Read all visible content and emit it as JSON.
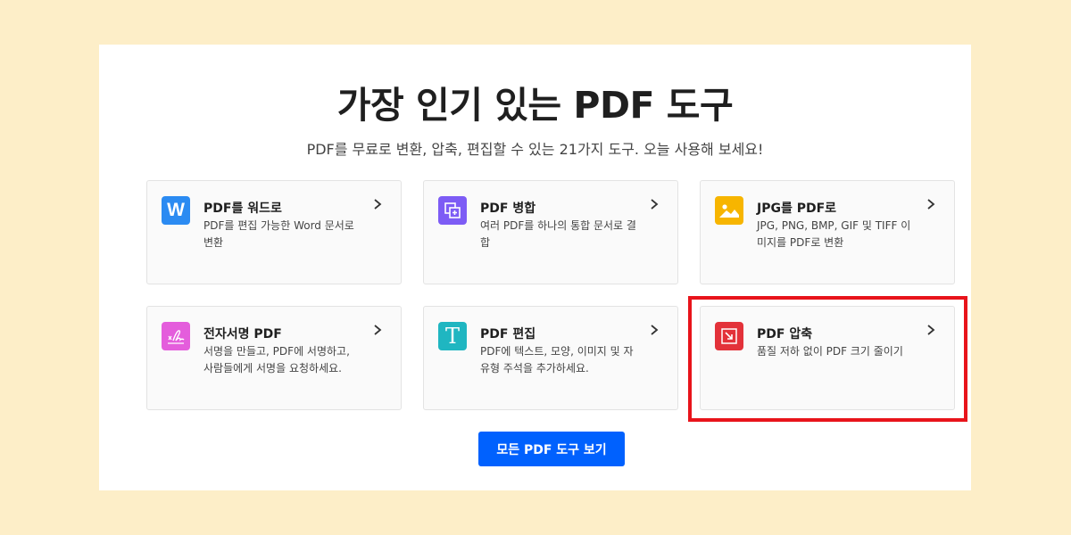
{
  "header": {
    "title": "가장 인기 있는 PDF 도구",
    "subtitle": "PDF를 무료로 변환, 압축, 편집할 수 있는 21가지 도구. 오늘 사용해 보세요!"
  },
  "tools": [
    {
      "name": "PDF를 워드로",
      "desc": "PDF를 편집 가능한 Word 문서로 변환",
      "icon": "word-icon",
      "icon_glyph": "W",
      "color": "#2b8bf2"
    },
    {
      "name": "PDF 병합",
      "desc": "여러 PDF를 하나의 통합 문서로 결합",
      "icon": "merge-icon",
      "color": "#7d5cf5"
    },
    {
      "name": "JPG를 PDF로",
      "desc": "JPG, PNG, BMP, GIF 및 TIFF 이미지를 PDF로 변환",
      "icon": "image-icon",
      "color": "#f7b500"
    },
    {
      "name": "전자서명 PDF",
      "desc": "서명을 만들고, PDF에 서명하고, 사람들에게 서명을 요청하세요.",
      "icon": "signature-icon",
      "color": "#e45ddc"
    },
    {
      "name": "PDF 편집",
      "desc": "PDF에 텍스트, 모양, 이미지 및 자유형 주석을 추가하세요.",
      "icon": "text-edit-icon",
      "icon_glyph": "T",
      "color": "#1fb6c1"
    },
    {
      "name": "PDF 압축",
      "desc": "품질 저하 없이 PDF 크기 줄이기",
      "icon": "compress-icon",
      "color": "#e3323a"
    }
  ],
  "cta": {
    "label": "모든 PDF 도구 보기",
    "color": "#0061fe"
  },
  "highlight_color": "#e8141b"
}
